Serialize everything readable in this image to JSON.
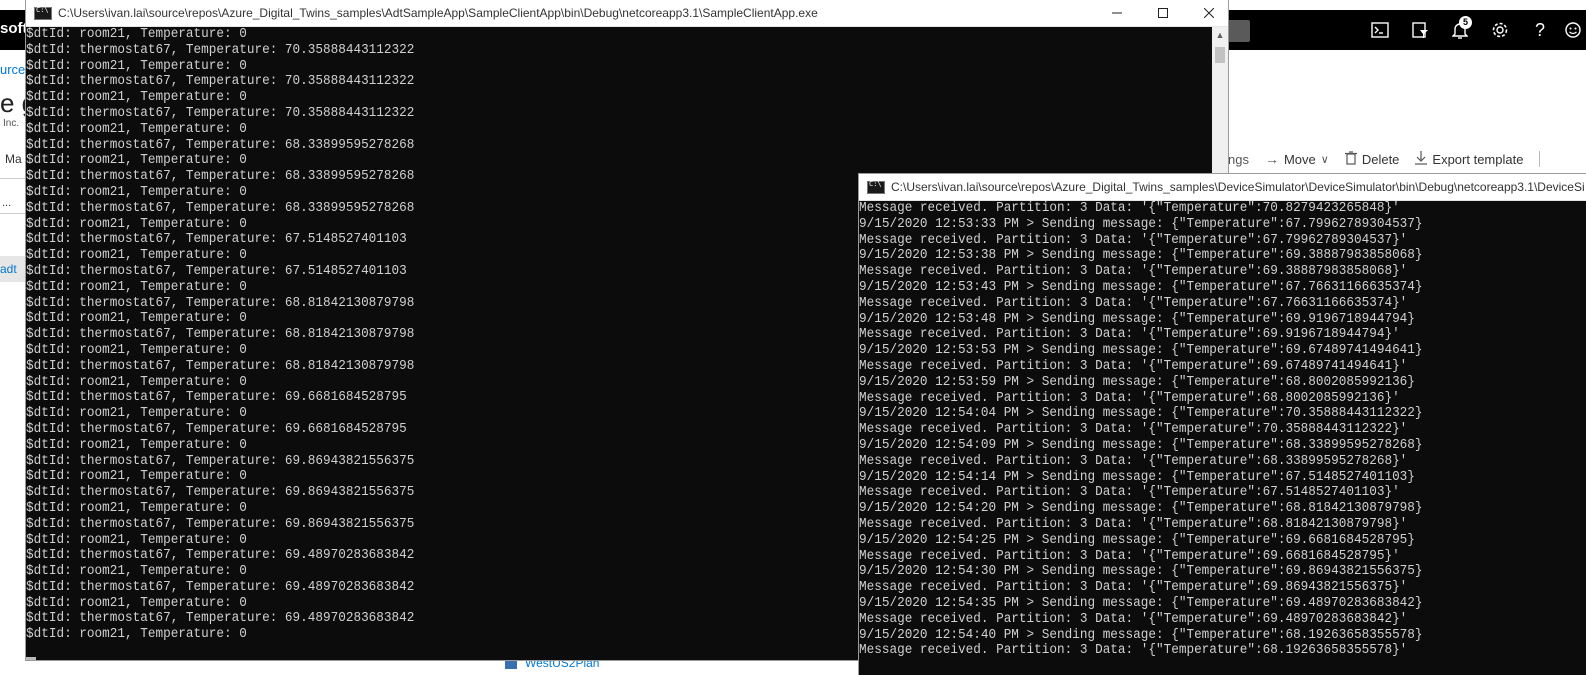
{
  "portal": {
    "brand": "soft",
    "resource_link": "urce",
    "title_fragment": "e g",
    "subtitle_fragment": "Inc.",
    "menu_fragment": "Ma",
    "filter_fragment": "...",
    "adt_fragment": "adt",
    "toolbar": {
      "tags_fragment": "ngs",
      "move": "Move",
      "delete": "Delete",
      "export": "Export template"
    },
    "list_item": "WestUS2Plan",
    "notification_count": "5",
    "icons": [
      "cloud-shell-icon",
      "directory-filter-icon",
      "bell-icon",
      "gear-icon",
      "help-icon",
      "feedback-icon"
    ]
  },
  "client_window": {
    "title": "C:\\Users\\ivan.lai\\source\\repos\\Azure_Digital_Twins_samples\\AdtSampleApp\\SampleClientApp\\bin\\Debug\\netcoreapp3.1\\SampleClientApp.exe",
    "lines": [
      "$dtId: room21, Temperature: 0",
      "$dtId: thermostat67, Temperature: 70.35888443112322",
      "$dtId: room21, Temperature: 0",
      "$dtId: thermostat67, Temperature: 70.35888443112322",
      "$dtId: room21, Temperature: 0",
      "$dtId: thermostat67, Temperature: 70.35888443112322",
      "$dtId: room21, Temperature: 0",
      "$dtId: thermostat67, Temperature: 68.33899595278268",
      "$dtId: room21, Temperature: 0",
      "$dtId: thermostat67, Temperature: 68.33899595278268",
      "$dtId: room21, Temperature: 0",
      "$dtId: thermostat67, Temperature: 68.33899595278268",
      "$dtId: room21, Temperature: 0",
      "$dtId: thermostat67, Temperature: 67.5148527401103",
      "$dtId: room21, Temperature: 0",
      "$dtId: thermostat67, Temperature: 67.5148527401103",
      "$dtId: room21, Temperature: 0",
      "$dtId: thermostat67, Temperature: 68.81842130879798",
      "$dtId: room21, Temperature: 0",
      "$dtId: thermostat67, Temperature: 68.81842130879798",
      "$dtId: room21, Temperature: 0",
      "$dtId: thermostat67, Temperature: 68.81842130879798",
      "$dtId: room21, Temperature: 0",
      "$dtId: thermostat67, Temperature: 69.6681684528795",
      "$dtId: room21, Temperature: 0",
      "$dtId: thermostat67, Temperature: 69.6681684528795",
      "$dtId: room21, Temperature: 0",
      "$dtId: thermostat67, Temperature: 69.86943821556375",
      "$dtId: room21, Temperature: 0",
      "$dtId: thermostat67, Temperature: 69.86943821556375",
      "$dtId: room21, Temperature: 0",
      "$dtId: thermostat67, Temperature: 69.86943821556375",
      "$dtId: room21, Temperature: 0",
      "$dtId: thermostat67, Temperature: 69.48970283683842",
      "$dtId: room21, Temperature: 0",
      "$dtId: thermostat67, Temperature: 69.48970283683842",
      "$dtId: room21, Temperature: 0",
      "$dtId: thermostat67, Temperature: 69.48970283683842",
      "$dtId: room21, Temperature: 0"
    ]
  },
  "simulator_window": {
    "title": "C:\\Users\\ivan.lai\\source\\repos\\Azure_Digital_Twins_samples\\DeviceSimulator\\DeviceSimulator\\bin\\Debug\\netcoreapp3.1\\DeviceSi",
    "lines": [
      "Message received. Partition: 3 Data: '{\"Temperature\":70.8279423265848}'",
      "9/15/2020 12:53:33 PM > Sending message: {\"Temperature\":67.79962789304537}",
      "Message received. Partition: 3 Data: '{\"Temperature\":67.79962789304537}'",
      "9/15/2020 12:53:38 PM > Sending message: {\"Temperature\":69.38887983858068}",
      "Message received. Partition: 3 Data: '{\"Temperature\":69.38887983858068}'",
      "9/15/2020 12:53:43 PM > Sending message: {\"Temperature\":67.76631166635374}",
      "Message received. Partition: 3 Data: '{\"Temperature\":67.76631166635374}'",
      "9/15/2020 12:53:48 PM > Sending message: {\"Temperature\":69.9196718944794}",
      "Message received. Partition: 3 Data: '{\"Temperature\":69.9196718944794}'",
      "9/15/2020 12:53:53 PM > Sending message: {\"Temperature\":69.67489741494641}",
      "Message received. Partition: 3 Data: '{\"Temperature\":69.67489741494641}'",
      "9/15/2020 12:53:59 PM > Sending message: {\"Temperature\":68.8002085992136}",
      "Message received. Partition: 3 Data: '{\"Temperature\":68.8002085992136}'",
      "9/15/2020 12:54:04 PM > Sending message: {\"Temperature\":70.35888443112322}",
      "Message received. Partition: 3 Data: '{\"Temperature\":70.35888443112322}'",
      "9/15/2020 12:54:09 PM > Sending message: {\"Temperature\":68.33899595278268}",
      "Message received. Partition: 3 Data: '{\"Temperature\":68.33899595278268}'",
      "9/15/2020 12:54:14 PM > Sending message: {\"Temperature\":67.5148527401103}",
      "Message received. Partition: 3 Data: '{\"Temperature\":67.5148527401103}'",
      "9/15/2020 12:54:20 PM > Sending message: {\"Temperature\":68.81842130879798}",
      "Message received. Partition: 3 Data: '{\"Temperature\":68.81842130879798}'",
      "9/15/2020 12:54:25 PM > Sending message: {\"Temperature\":69.6681684528795}",
      "Message received. Partition: 3 Data: '{\"Temperature\":69.6681684528795}'",
      "9/15/2020 12:54:30 PM > Sending message: {\"Temperature\":69.86943821556375}",
      "Message received. Partition: 3 Data: '{\"Temperature\":69.86943821556375}'",
      "9/15/2020 12:54:35 PM > Sending message: {\"Temperature\":69.48970283683842}",
      "Message received. Partition: 3 Data: '{\"Temperature\":69.48970283683842}'",
      "9/15/2020 12:54:40 PM > Sending message: {\"Temperature\":68.19263658355578}",
      "Message received. Partition: 3 Data: '{\"Temperature\":68.19263658355578}'"
    ]
  },
  "colors": {
    "console_bg": "#0c0c0c",
    "console_text": "#d0d0d0",
    "portal_bar": "#000000",
    "link": "#0078d4"
  }
}
